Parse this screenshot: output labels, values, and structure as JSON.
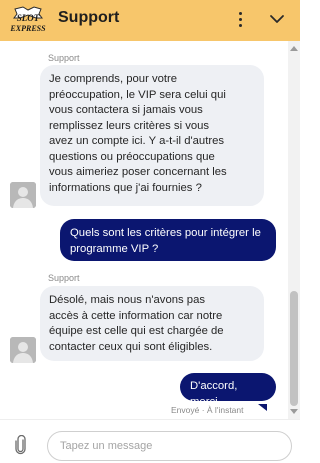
{
  "header": {
    "title": "Support",
    "logo_text": [
      "SLOT",
      "EXPRESS"
    ],
    "menu_icon": "kebab-menu-icon",
    "collapse_icon": "chevron-down-icon",
    "background_color": "#f7c66b"
  },
  "conversation": {
    "messages": [
      {
        "direction": "incoming",
        "sender": "Support",
        "text": "Je comprends, pour votre\npréoccupation, le VIP sera celui qui\nvous contactera si jamais vous\nremplissez leurs critères si vous\navez un compte ici. Y a-t-il d'autres\nquestions ou préoccupations que\nvous aimeriez poser concernant les\ninformations que j'ai fournies ?"
      },
      {
        "direction": "outgoing",
        "text": "Quels sont les critères pour intégrer le\nprogramme VIP ?"
      },
      {
        "direction": "incoming",
        "sender": "Support",
        "text": "Désolé, mais nous n'avons pas\naccès à cette information car notre\néquipe est celle qui est chargée de\ncontacter ceux qui sont éligibles."
      },
      {
        "direction": "outgoing",
        "text": "D'accord, merci",
        "status": "Envoyé · À l'instant"
      }
    ]
  },
  "composer": {
    "placeholder": "Tapez un message",
    "attach_icon": "paperclip-icon"
  },
  "colors": {
    "outgoing_bubble": "#0b1670",
    "incoming_bubble": "#eef0f4"
  }
}
